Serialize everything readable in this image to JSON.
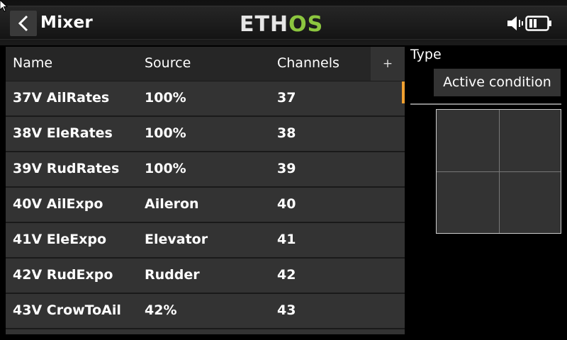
{
  "header": {
    "title": "Mixer",
    "logo_main": "ETH",
    "logo_accent": "OS"
  },
  "table": {
    "columns": [
      "Name",
      "Source",
      "Channels"
    ],
    "add_label": "+",
    "rows": [
      {
        "name": "37V AilRates",
        "source": "100%",
        "channel": "37"
      },
      {
        "name": "38V EleRates",
        "source": "100%",
        "channel": "38"
      },
      {
        "name": "39V RudRates",
        "source": "100%",
        "channel": "39"
      },
      {
        "name": "40V AilExpo",
        "source": "Aileron",
        "channel": "40"
      },
      {
        "name": "41V EleExpo",
        "source": "Elevator",
        "channel": "41"
      },
      {
        "name": "42V RudExpo",
        "source": "Rudder",
        "channel": "42"
      },
      {
        "name": "43V CrowToAil",
        "source": "42%",
        "channel": "43"
      }
    ]
  },
  "panel": {
    "type_label": "Type",
    "type_value": "Active condition"
  },
  "colors": {
    "accent": "#8cc63f",
    "scroll_thumb": "#f0a030"
  }
}
